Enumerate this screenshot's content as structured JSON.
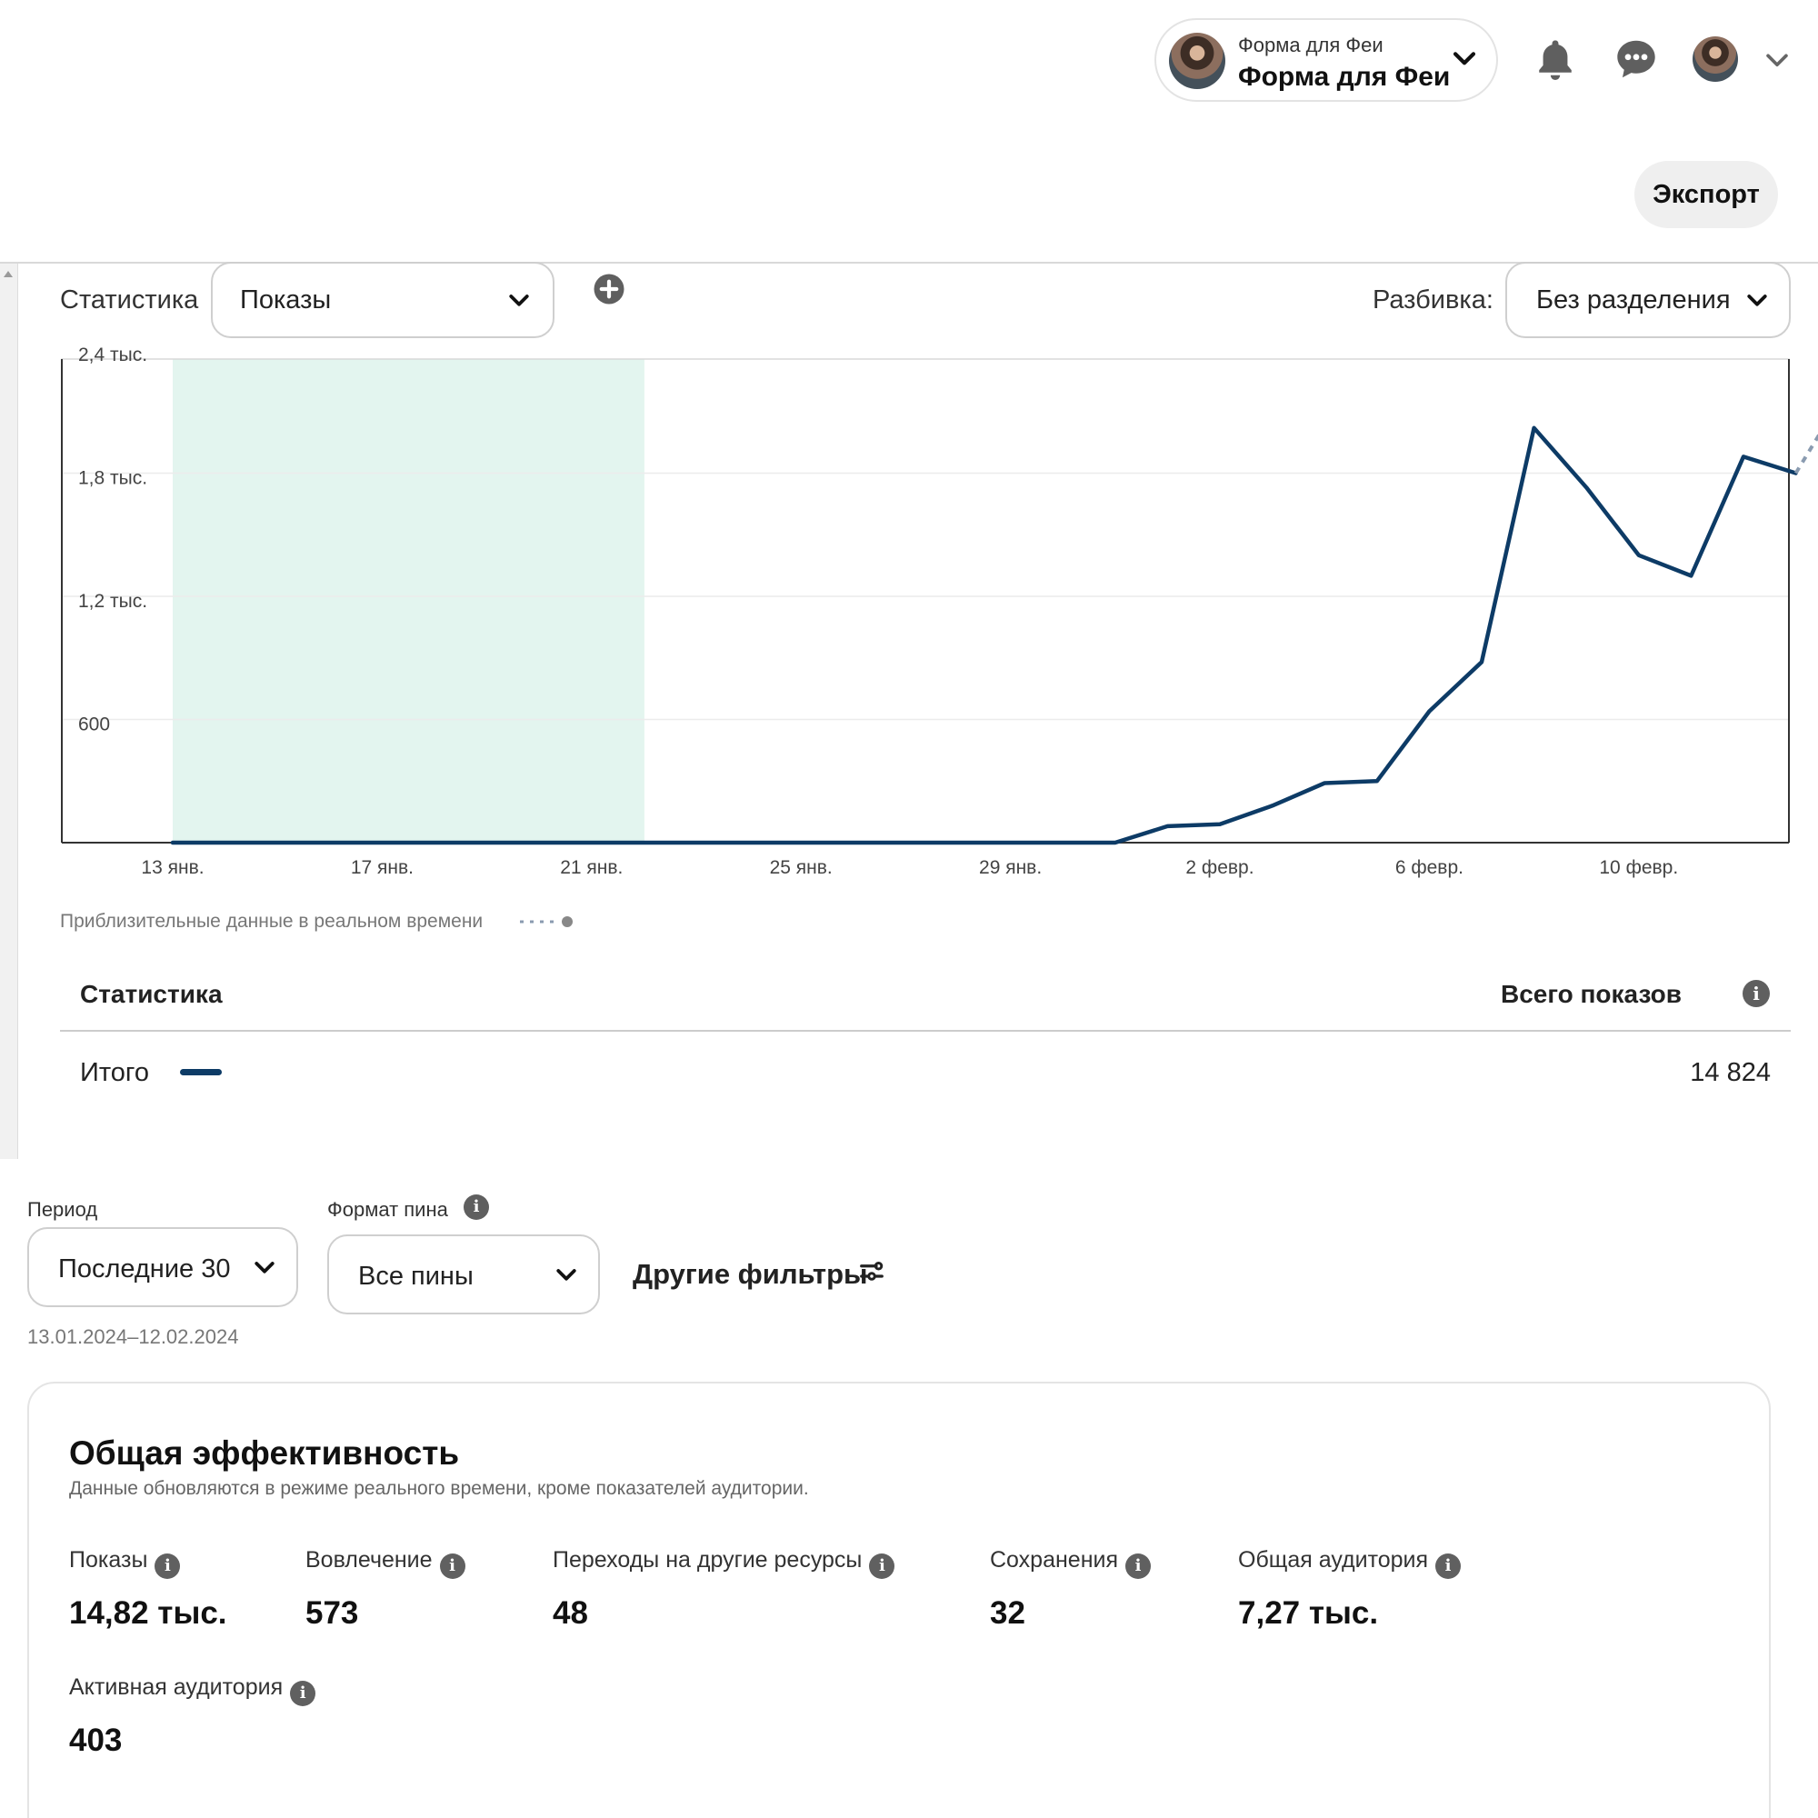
{
  "header": {
    "account_sub": "Форма для Феи",
    "account_name": "Форма для Феи",
    "export_label": "Экспорт",
    "icons": [
      "bell-icon",
      "chat-icon",
      "chevron-down-icon"
    ]
  },
  "chart_controls": {
    "metric_label": "Статистика",
    "metric_value": "Показы",
    "breakdown_label": "Разбивка:",
    "breakdown_value": "Без разделения"
  },
  "chart_data": {
    "type": "line",
    "y_ticks": [
      "600",
      "1,2 тыс.",
      "1,8 тыс.",
      "2,4 тыс."
    ],
    "x_ticks": [
      "13 янв.",
      "17 янв.",
      "21 янв.",
      "25 янв.",
      "29 янв.",
      "2 февр.",
      "6 февр.",
      "10 февр."
    ],
    "ylim": [
      0,
      2400
    ],
    "series": [
      {
        "values": [
          0,
          0,
          0,
          0,
          0,
          0,
          0,
          0,
          0,
          0,
          0,
          0,
          0,
          0,
          0,
          0,
          0,
          0,
          0,
          80,
          90,
          180,
          290,
          300,
          640,
          880,
          2020,
          1730,
          1400,
          1300,
          1880,
          1800
        ]
      }
    ],
    "estimate_value": 2230,
    "highlight_range": [
      "13 янв.",
      "22 янв."
    ],
    "grid": true,
    "colors": {
      "line": "#0d3b66",
      "highlight": "#e3f5ef",
      "estimate": "#8a9bb0"
    },
    "legend_note": "Приблизительные данные в реальном времени"
  },
  "summary_table": {
    "col_left": "Статистика",
    "col_right": "Всего показов",
    "row_label": "Итого",
    "row_value": "14 824"
  },
  "filters": {
    "period_label": "Период",
    "period_value": "Последние 30",
    "format_label": "Формат пина",
    "format_value": "Все пины",
    "more_filters": "Другие фильтры",
    "date_range": "13.01.2024–12.02.2024"
  },
  "overview": {
    "title": "Общая эффективность",
    "subtitle": "Данные обновляются в режиме реального времени, кроме показателей аудитории.",
    "metrics": [
      {
        "label": "Показы",
        "value": "14,82 тыс."
      },
      {
        "label": "Вовлечение",
        "value": "573"
      },
      {
        "label": "Переходы на другие ресурсы",
        "value": "48"
      },
      {
        "label": "Сохранения",
        "value": "32"
      },
      {
        "label": "Общая аудитория",
        "value": "7,27 тыс."
      },
      {
        "label": "Активная аудитория",
        "value": "403"
      }
    ]
  }
}
